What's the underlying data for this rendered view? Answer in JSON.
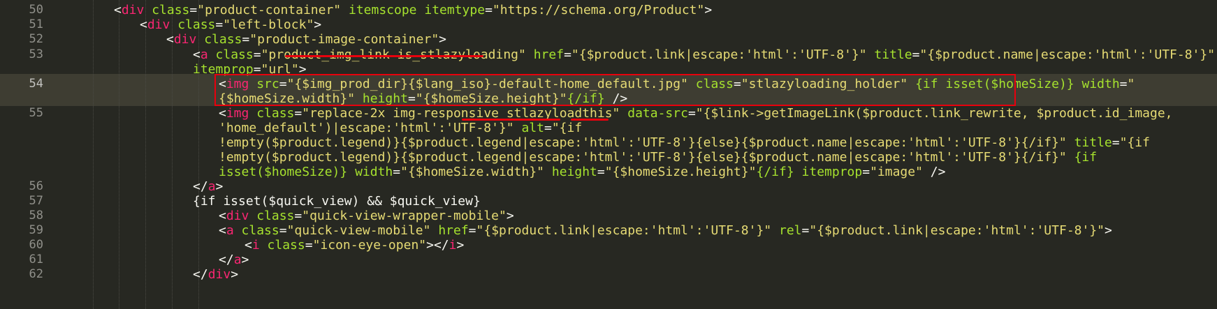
{
  "editor": {
    "lines": [
      {
        "n": "50",
        "segs": [
          [
            "p",
            "<"
          ],
          [
            "t",
            "div"
          ],
          [
            "p",
            " "
          ],
          [
            "a",
            "class"
          ],
          [
            "p",
            "="
          ],
          [
            "s",
            "\"product-container\""
          ],
          [
            "p",
            " "
          ],
          [
            "a",
            "itemscope"
          ],
          [
            "p",
            " "
          ],
          [
            "a",
            "itemtype"
          ],
          [
            "p",
            "="
          ],
          [
            "s",
            "\"https://schema.org/Product\""
          ],
          [
            "p",
            ">"
          ]
        ]
      },
      {
        "n": "51",
        "segs": [
          [
            "p",
            "<"
          ],
          [
            "t",
            "div"
          ],
          [
            "p",
            " "
          ],
          [
            "a",
            "class"
          ],
          [
            "p",
            "="
          ],
          [
            "s",
            "\"left-block\""
          ],
          [
            "p",
            ">"
          ]
        ]
      },
      {
        "n": "52",
        "segs": [
          [
            "p",
            "<"
          ],
          [
            "t",
            "div"
          ],
          [
            "p",
            " "
          ],
          [
            "a",
            "class"
          ],
          [
            "p",
            "="
          ],
          [
            "s",
            "\"product-image-container\""
          ],
          [
            "p",
            ">"
          ]
        ]
      },
      {
        "n": "53",
        "segs": [
          [
            "p",
            "<"
          ],
          [
            "t",
            "a"
          ],
          [
            "p",
            " "
          ],
          [
            "a",
            "class"
          ],
          [
            "p",
            "="
          ],
          [
            "s",
            "\"product_img_link is_stlazyloading\""
          ],
          [
            "p",
            " "
          ],
          [
            "a",
            "href"
          ],
          [
            "p",
            "="
          ],
          [
            "s",
            "\"{$product.link|escape:'html':'UTF-8'}\""
          ],
          [
            "p",
            " "
          ],
          [
            "a",
            "title"
          ],
          [
            "p",
            "="
          ],
          [
            "s",
            "\"{$product.name|escape:'html':'UTF-8'}\""
          ]
        ]
      },
      {
        "n": "",
        "segs": [
          [
            "a",
            "itemprop"
          ],
          [
            "p",
            "="
          ],
          [
            "s",
            "\"url\""
          ],
          [
            "p",
            ">"
          ]
        ]
      },
      {
        "n": "54",
        "segs": [
          [
            "p",
            "<"
          ],
          [
            "t",
            "img"
          ],
          [
            "p",
            " "
          ],
          [
            "a",
            "src"
          ],
          [
            "p",
            "="
          ],
          [
            "s",
            "\"{$img_prod_dir}{$lang_iso}-default-home_default.jpg\""
          ],
          [
            "p",
            " "
          ],
          [
            "a",
            "class"
          ],
          [
            "p",
            "="
          ],
          [
            "s",
            "\"stlazyloading_holder\""
          ],
          [
            "p",
            " "
          ],
          [
            "g",
            "{if isset($homeSize)}"
          ],
          [
            "p",
            " "
          ],
          [
            "a",
            "width"
          ],
          [
            "p",
            "="
          ],
          [
            "s",
            "\""
          ]
        ]
      },
      {
        "n": "",
        "segs": [
          [
            "s",
            "{$homeSize.width}\""
          ],
          [
            "p",
            " "
          ],
          [
            "a",
            "height"
          ],
          [
            "p",
            "="
          ],
          [
            "s",
            "\"{$homeSize.height}\""
          ],
          [
            "g",
            "{/if}"
          ],
          [
            "p",
            " />"
          ]
        ]
      },
      {
        "n": "55",
        "segs": [
          [
            "p",
            "<"
          ],
          [
            "t",
            "img"
          ],
          [
            "p",
            " "
          ],
          [
            "a",
            "class"
          ],
          [
            "p",
            "="
          ],
          [
            "s",
            "\"replace-2x img-responsive stlazyloadthis\""
          ],
          [
            "p",
            " "
          ],
          [
            "a",
            "data-src"
          ],
          [
            "p",
            "="
          ],
          [
            "s",
            "\"{$link->getImageLink($product.link_rewrite, $product.id_image,"
          ]
        ]
      },
      {
        "n": "",
        "segs": [
          [
            "s",
            "'home_default')|escape:'html':'UTF-8'}\""
          ],
          [
            "p",
            " "
          ],
          [
            "a",
            "alt"
          ],
          [
            "p",
            "="
          ],
          [
            "s",
            "\"{if"
          ]
        ]
      },
      {
        "n": "",
        "segs": [
          [
            "s",
            "!empty($product.legend)}{$product.legend|escape:'html':'UTF-8'}{else}{$product.name|escape:'html':'UTF-8'}{/if}\""
          ],
          [
            "p",
            " "
          ],
          [
            "a",
            "title"
          ],
          [
            "p",
            "="
          ],
          [
            "s",
            "\"{if"
          ]
        ]
      },
      {
        "n": "",
        "segs": [
          [
            "s",
            "!empty($product.legend)}{$product.legend|escape:'html':'UTF-8'}{else}{$product.name|escape:'html':'UTF-8'}{/if}\""
          ],
          [
            "p",
            " "
          ],
          [
            "g",
            "{if"
          ]
        ]
      },
      {
        "n": "",
        "segs": [
          [
            "g",
            "isset($homeSize)}"
          ],
          [
            "p",
            " "
          ],
          [
            "a",
            "width"
          ],
          [
            "p",
            "="
          ],
          [
            "s",
            "\"{$homeSize.width}\""
          ],
          [
            "p",
            " "
          ],
          [
            "a",
            "height"
          ],
          [
            "p",
            "="
          ],
          [
            "s",
            "\"{$homeSize.height}\""
          ],
          [
            "g",
            "{/if}"
          ],
          [
            "p",
            " "
          ],
          [
            "a",
            "itemprop"
          ],
          [
            "p",
            "="
          ],
          [
            "s",
            "\"image\""
          ],
          [
            "p",
            " />"
          ]
        ]
      },
      {
        "n": "56",
        "segs": [
          [
            "p",
            "</"
          ],
          [
            "t",
            "a"
          ],
          [
            "p",
            ">"
          ]
        ]
      },
      {
        "n": "57",
        "segs": [
          [
            "p",
            "{if isset($quick_view) && $quick_view}"
          ]
        ]
      },
      {
        "n": "58",
        "segs": [
          [
            "p",
            "<"
          ],
          [
            "t",
            "div"
          ],
          [
            "p",
            " "
          ],
          [
            "a",
            "class"
          ],
          [
            "p",
            "="
          ],
          [
            "s",
            "\"quick-view-wrapper-mobile\""
          ],
          [
            "p",
            ">"
          ]
        ]
      },
      {
        "n": "59",
        "segs": [
          [
            "p",
            "<"
          ],
          [
            "t",
            "a"
          ],
          [
            "p",
            " "
          ],
          [
            "a",
            "class"
          ],
          [
            "p",
            "="
          ],
          [
            "s",
            "\"quick-view-mobile\""
          ],
          [
            "p",
            " "
          ],
          [
            "a",
            "href"
          ],
          [
            "p",
            "="
          ],
          [
            "s",
            "\"{$product.link|escape:'html':'UTF-8'}\""
          ],
          [
            "p",
            " "
          ],
          [
            "a",
            "rel"
          ],
          [
            "p",
            "="
          ],
          [
            "s",
            "\"{$product.link|escape:'html':'UTF-8'}\""
          ],
          [
            "p",
            ">"
          ]
        ]
      },
      {
        "n": "60",
        "segs": [
          [
            "p",
            "<"
          ],
          [
            "t",
            "i"
          ],
          [
            "p",
            " "
          ],
          [
            "a",
            "class"
          ],
          [
            "p",
            "="
          ],
          [
            "s",
            "\"icon-eye-open\""
          ],
          [
            "p",
            "></"
          ],
          [
            "t",
            "i"
          ],
          [
            "p",
            ">"
          ]
        ]
      },
      {
        "n": "61",
        "segs": [
          [
            "p",
            "</"
          ],
          [
            "t",
            "a"
          ],
          [
            "p",
            ">"
          ]
        ]
      },
      {
        "n": "62",
        "segs": [
          [
            "p",
            "</"
          ],
          [
            "t",
            "div"
          ],
          [
            "p",
            ">"
          ]
        ]
      }
    ]
  },
  "colors": {
    "background": "#272822",
    "gutter_text": "#90908a",
    "tag": "#f92672",
    "attribute": "#a6e22e",
    "string": "#e6db74",
    "plain": "#f8f8f2",
    "annotation": "#e8000d"
  }
}
